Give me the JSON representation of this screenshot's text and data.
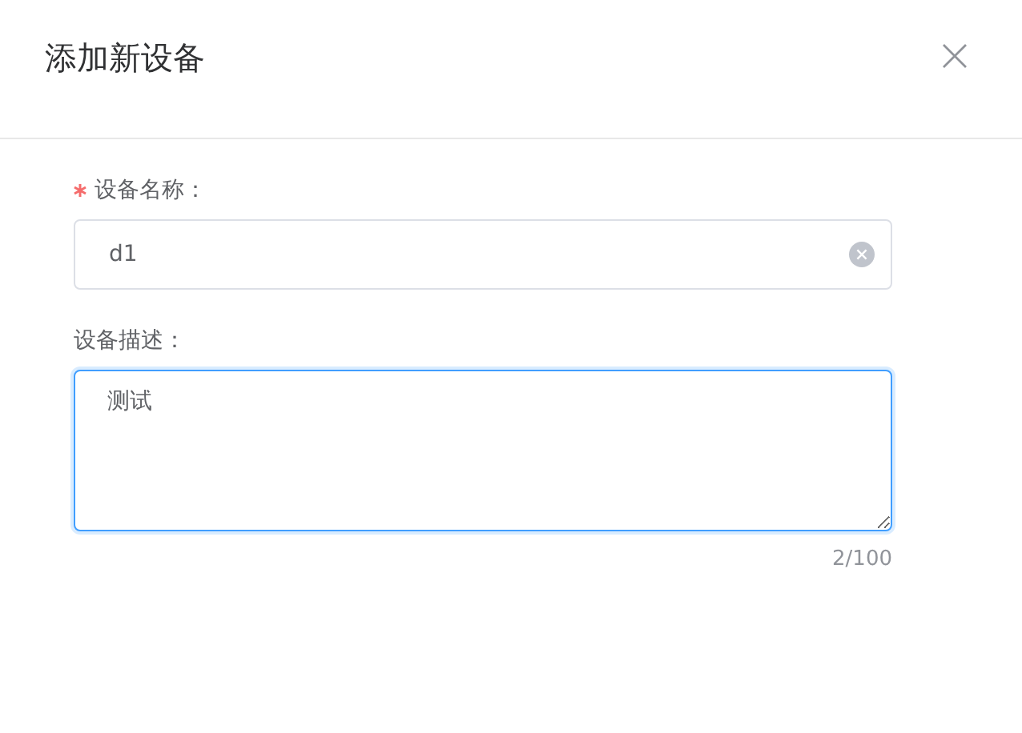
{
  "dialog": {
    "title": "添加新设备",
    "closable": true
  },
  "fields": [
    {
      "kind": "input",
      "label": "设备名称：",
      "required": true,
      "value": "d1",
      "clearable": true,
      "focused": false
    },
    {
      "kind": "textarea",
      "label": "设备描述：",
      "required": false,
      "value": "测试",
      "focused": true,
      "counter": "2/100"
    }
  ]
}
